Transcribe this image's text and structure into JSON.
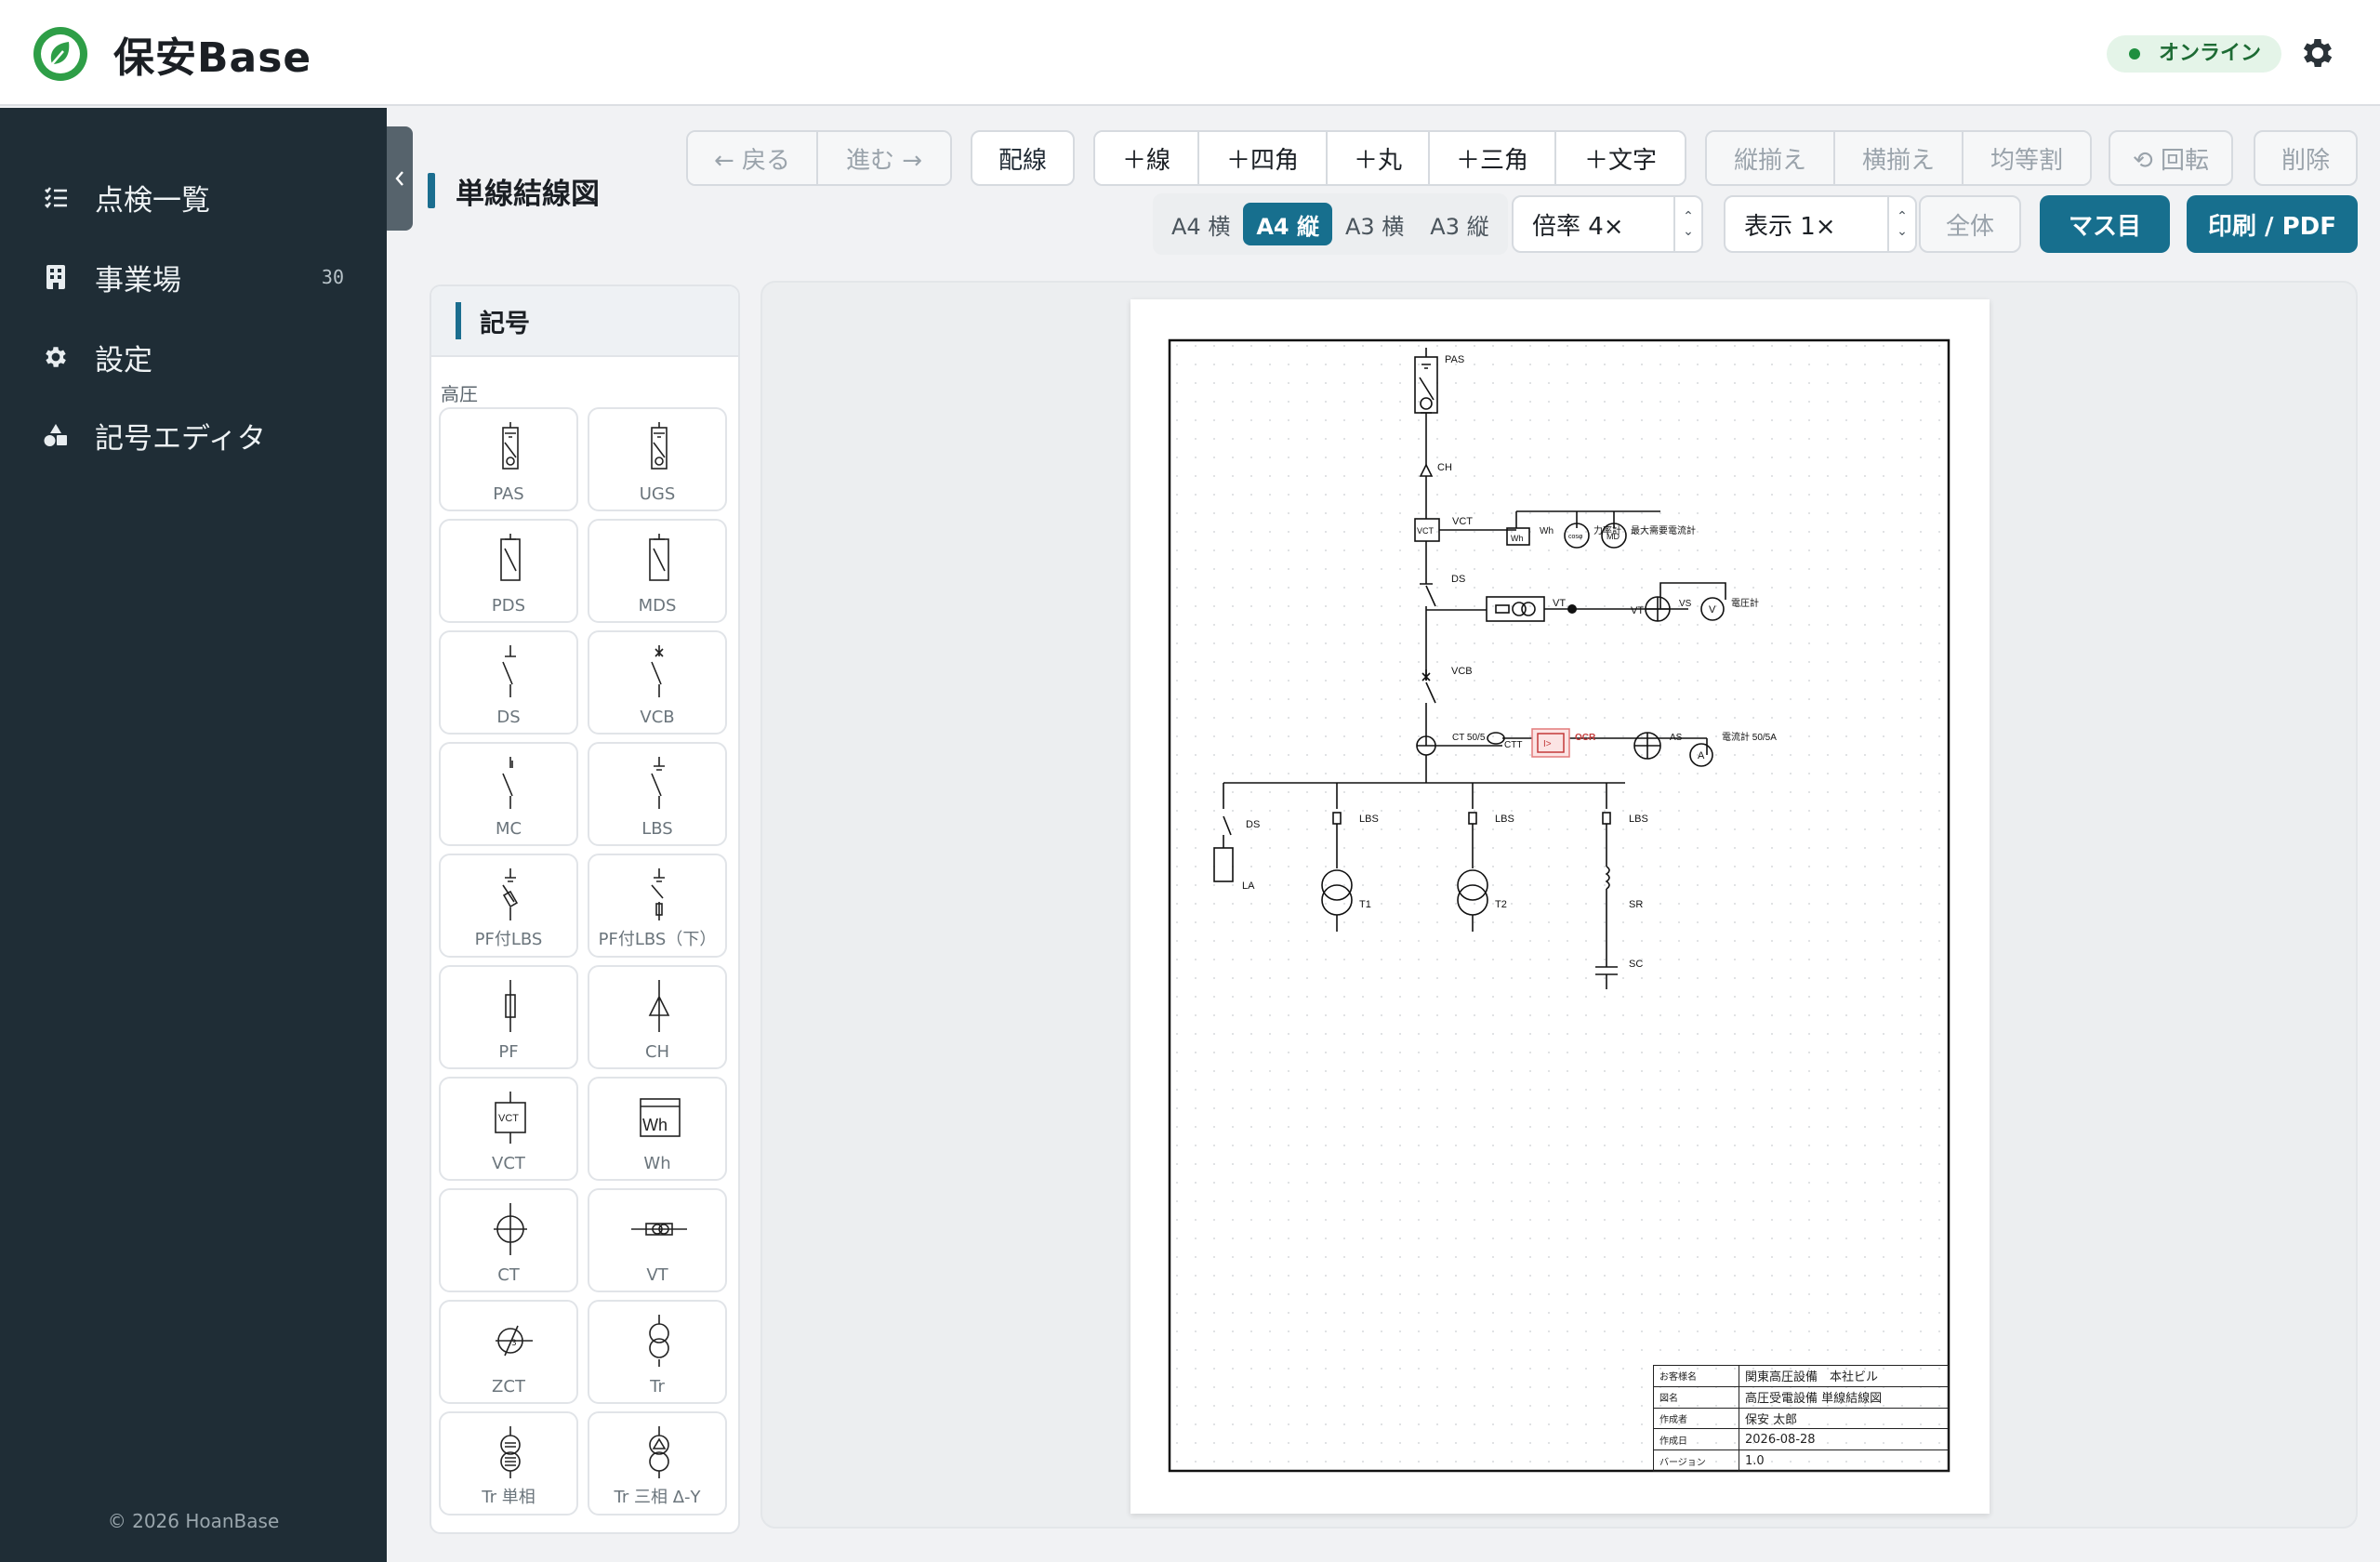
{
  "app": {
    "title": "保安Base",
    "status": "オンライン"
  },
  "sidebar": {
    "items": [
      {
        "label": "点検一覧",
        "icon": "checklist-icon",
        "count": ""
      },
      {
        "label": "事業場",
        "icon": "building-icon",
        "count": "30"
      },
      {
        "label": "設定",
        "icon": "gear-icon",
        "count": ""
      },
      {
        "label": "記号エディタ",
        "icon": "shapes-icon",
        "count": ""
      }
    ],
    "copyright": "© 2026 HoanBase"
  },
  "page": {
    "title": "単線結線図"
  },
  "toolbar": {
    "back": "← 戻る",
    "forward": "進む →",
    "wiring": "配線",
    "add_line": "＋線",
    "add_rect": "＋四角",
    "add_circle": "＋丸",
    "add_triangle": "＋三角",
    "add_text": "＋文字",
    "align_v": "縦揃え",
    "align_h": "横揃え",
    "distribute": "均等割",
    "rotate": "⟲ 回転",
    "delete": "削除",
    "paper_options": [
      "A4 横",
      "A4 縦",
      "A3 横",
      "A3 縦"
    ],
    "paper_selected": "A4 縦",
    "scale": "倍率 4×",
    "display": "表示 1×",
    "fit": "全体",
    "grid": "マス目",
    "print": "印刷 / PDF"
  },
  "symbols": {
    "panel_title": "記号",
    "section": "高圧",
    "items": [
      "PAS",
      "UGS",
      "PDS",
      "MDS",
      "DS",
      "VCB",
      "MC",
      "LBS",
      "PF付LBS",
      "PF付LBS（下）",
      "PF",
      "CH",
      "VCT",
      "Wh",
      "CT",
      "VT",
      "ZCT",
      "Tr",
      "Tr 単相",
      "Tr 三相 Δ-Y"
    ]
  },
  "diagram": {
    "labels": {
      "pas": "PAS",
      "ch": "CH",
      "vct": "VCT",
      "wh": "Wh",
      "cos": "cosφ",
      "power_factor": "力率計",
      "md": "MD",
      "max_demand": "最大需要電流計",
      "ds": "DS",
      "vt": "VT",
      "vt2": "VT",
      "vs": "VS",
      "v": "V",
      "voltmeter": "電圧計",
      "vcb": "VCB",
      "ct": "CT 50/5",
      "ctt": "CTT",
      "ocr_box": "I>",
      "ocr": "OCR",
      "as": "AS",
      "a": "A",
      "ammeter": "電流計 50/5A",
      "ds2": "DS",
      "la": "LA",
      "lbs1": "LBS",
      "lbs2": "LBS",
      "lbs3": "LBS",
      "t1": "T1",
      "t2": "T2",
      "sr": "SR",
      "sc": "SC"
    },
    "title_block": [
      {
        "key": "お客様名",
        "value": "関東高圧設備　本社ビル"
      },
      {
        "key": "図名",
        "value": "高圧受電設備 単線結線図"
      },
      {
        "key": "作成者",
        "value": "保安 太郎"
      },
      {
        "key": "作成日",
        "value": "2026-08-28"
      },
      {
        "key": "バージョン",
        "value": "1.0"
      }
    ]
  }
}
